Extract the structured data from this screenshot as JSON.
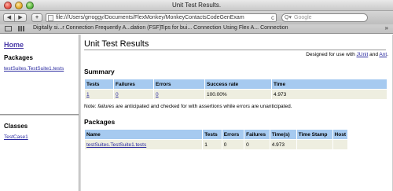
{
  "window": {
    "title": "Unit Test Results."
  },
  "toolbar": {
    "back_label": "◀",
    "forward_label": "▶",
    "add_label": "+",
    "url": "file:///Users/grroggy/Documents/FlexMonkey/MonkeyContactsCodeGenExam",
    "reload_label": "c",
    "search_placeholder": "Google",
    "search_icon_label": "Q▾"
  },
  "bookmarks": {
    "items": [
      "Digitally si...r Connection",
      "Frequently A...dation (FSF)",
      "Tips for bui... Connection",
      "Using Flex A... Connection"
    ],
    "more_label": "»"
  },
  "sidebar": {
    "home_label": "Home",
    "packages_heading": "Packages",
    "packages": [
      "testSuites.TestSuite1.tests"
    ],
    "classes_heading": "Classes",
    "classes": [
      "TestCase1"
    ]
  },
  "main": {
    "title": "Unit Test Results",
    "designed_prefix": "Designed for use with ",
    "junit_link": "JUnit",
    "designed_and": " and ",
    "ant_link": "Ant",
    "designed_suffix": ".",
    "summary_heading": "Summary",
    "summary_headers": [
      "Tests",
      "Failures",
      "Errors",
      "Success rate",
      "Time"
    ],
    "summary_row": [
      "1",
      "0",
      "0",
      "100.00%",
      "4.973"
    ],
    "note_prefix": "Note: ",
    "note_failures": "failures",
    "note_mid": " are anticipated and checked for with assertions while ",
    "note_errors": "errors",
    "note_suffix": " are unanticipated.",
    "packages_heading": "Packages",
    "packages_headers": [
      "Name",
      "Tests",
      "Errors",
      "Failures",
      "Time(s)",
      "Time Stamp",
      "Host"
    ],
    "packages_row": [
      "testSuites.TestSuite1.tests",
      "1",
      "0",
      "0",
      "4.973",
      "",
      ""
    ]
  }
}
